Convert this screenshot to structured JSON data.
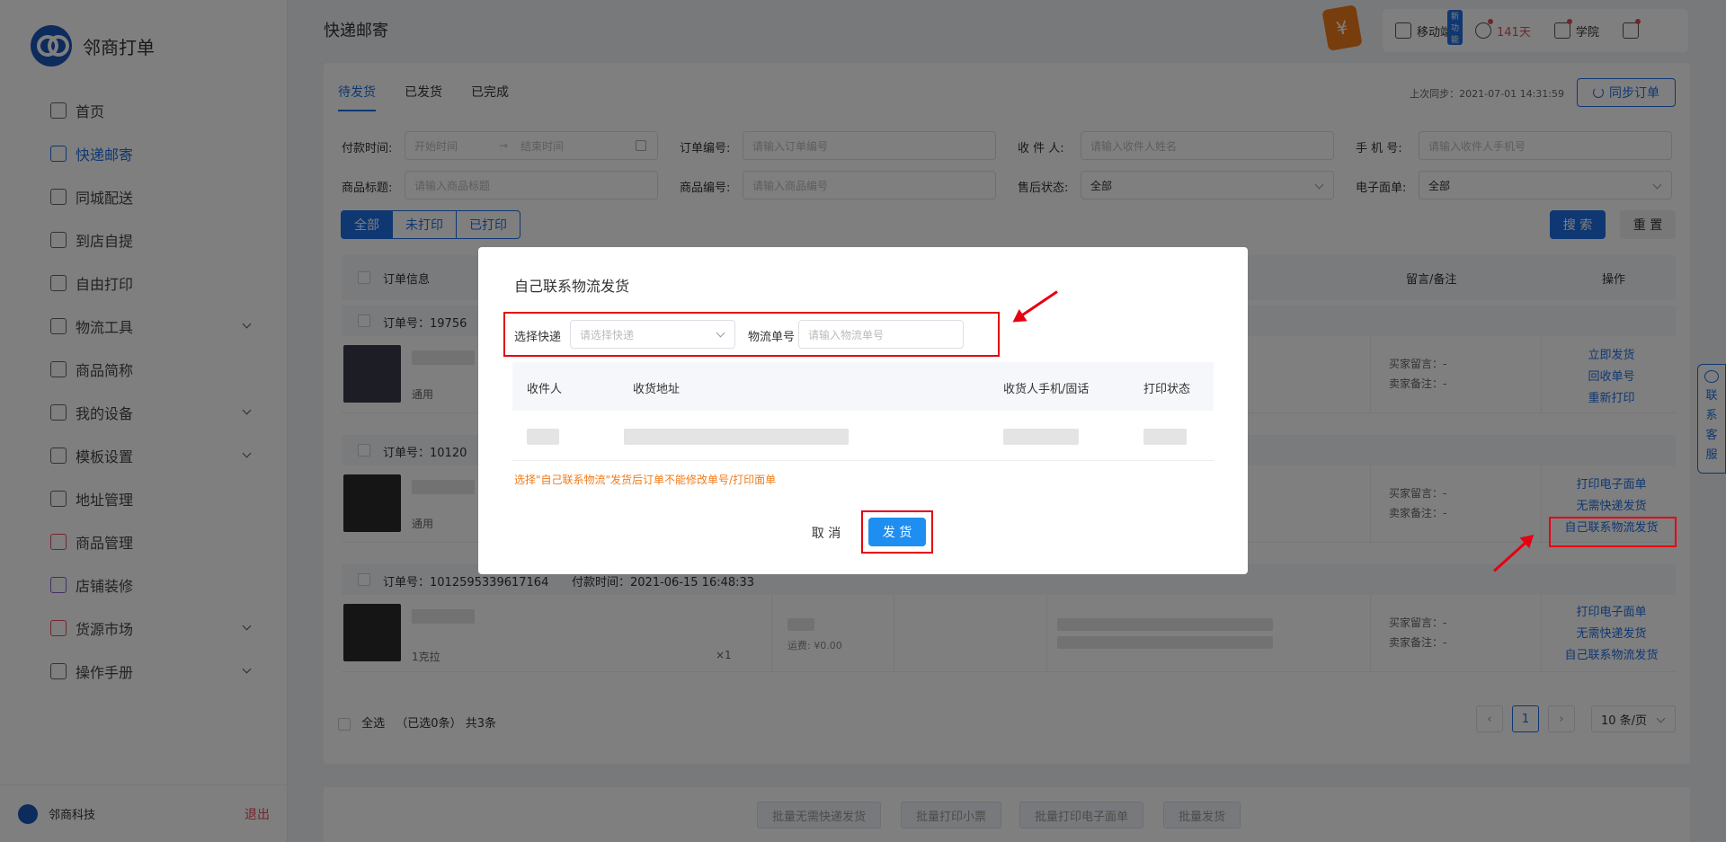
{
  "app": {
    "name": "邻商打单"
  },
  "sidebar": {
    "items": [
      {
        "label": "首页"
      },
      {
        "label": "快递邮寄"
      },
      {
        "label": "同城配送"
      },
      {
        "label": "到店自提"
      },
      {
        "label": "自由打印"
      },
      {
        "label": "物流工具"
      },
      {
        "label": "商品简称"
      },
      {
        "label": "我的设备"
      },
      {
        "label": "模板设置"
      },
      {
        "label": "地址管理"
      },
      {
        "label": "商品管理"
      },
      {
        "label": "店铺装修"
      },
      {
        "label": "货源市场"
      },
      {
        "label": "操作手册"
      }
    ],
    "company": "邻商科技",
    "logout": "退出"
  },
  "header": {
    "title": "快递邮寄",
    "money_icon": "¥",
    "mobile_label": "移动端",
    "new_badge": "新功能",
    "days": "141天",
    "academy": "学院"
  },
  "main": {
    "tabs": [
      "待发货",
      "已发货",
      "已完成"
    ],
    "last_sync": "上次同步：2021-07-01 14:31:59",
    "sync_button": "同步订单",
    "filters": {
      "pay_time_label": "付款时间:",
      "start_placeholder": "开始时间",
      "end_placeholder": "结束时间",
      "order_no_label": "订单编号:",
      "order_no_placeholder": "请输入订单编号",
      "receiver_label": "收 件 人:",
      "receiver_placeholder": "请输入收件人姓名",
      "phone_label": "手 机 号:",
      "phone_placeholder": "请输入收件人手机号",
      "title_label": "商品标题:",
      "title_placeholder": "请输入商品标题",
      "goods_no_label": "商品编号:",
      "goods_no_placeholder": "请输入商品编号",
      "after_sale_label": "售后状态:",
      "after_sale_value": "全部",
      "waybill_label": "电子面单:",
      "waybill_value": "全部"
    },
    "segments": [
      "全部",
      "未打印",
      "已打印"
    ],
    "search": "搜 索",
    "reset": "重 置",
    "table_headers": {
      "order_info": "订单信息",
      "remark": "留言/备注",
      "ops": "操作"
    },
    "orders": [
      {
        "order_no": "订单号：19756",
        "spec": "通用",
        "buyer_remark": "买家留言：-",
        "seller_remark": "卖家备注：-",
        "ops": [
          "立即发货",
          "回收单号",
          "重新打印"
        ]
      },
      {
        "order_no": "订单号：10120",
        "spec": "通用",
        "buyer_remark": "买家留言：-",
        "seller_remark": "卖家备注：-",
        "ops": [
          "打印电子面单",
          "无需快递发货",
          "自己联系物流发货"
        ]
      },
      {
        "order_no": "订单号：1012595339617164",
        "pay_time": "付款时间：2021-06-15 16:48:33",
        "spec": "1克拉",
        "qty": "×1",
        "freight": "运费: ¥0.00",
        "buyer_remark": "买家留言：-",
        "seller_remark": "卖家备注：-",
        "ops": [
          "打印电子面单",
          "无需快递发货",
          "自己联系物流发货"
        ]
      }
    ],
    "select_all": "全选",
    "selected_count": "（已选0条）",
    "total": "共3条",
    "page": "1",
    "page_size": "10 条/页"
  },
  "bottom_bar": [
    "批量无需快递发货",
    "批量打印小票",
    "批量打印电子面单",
    "批量发货"
  ],
  "chat": "联系客服",
  "modal": {
    "title": "自己联系物流发货",
    "express_label": "选择快递",
    "express_placeholder": "请选择快递",
    "tracking_label": "物流单号",
    "tracking_placeholder": "请输入物流单号",
    "columns": [
      "收件人",
      "收货地址",
      "收货人手机/固话",
      "打印状态"
    ],
    "warning": "选择\"自己联系物流\"发货后订单不能修改单号/打印面单",
    "cancel": "取 消",
    "confirm": "发 货"
  }
}
